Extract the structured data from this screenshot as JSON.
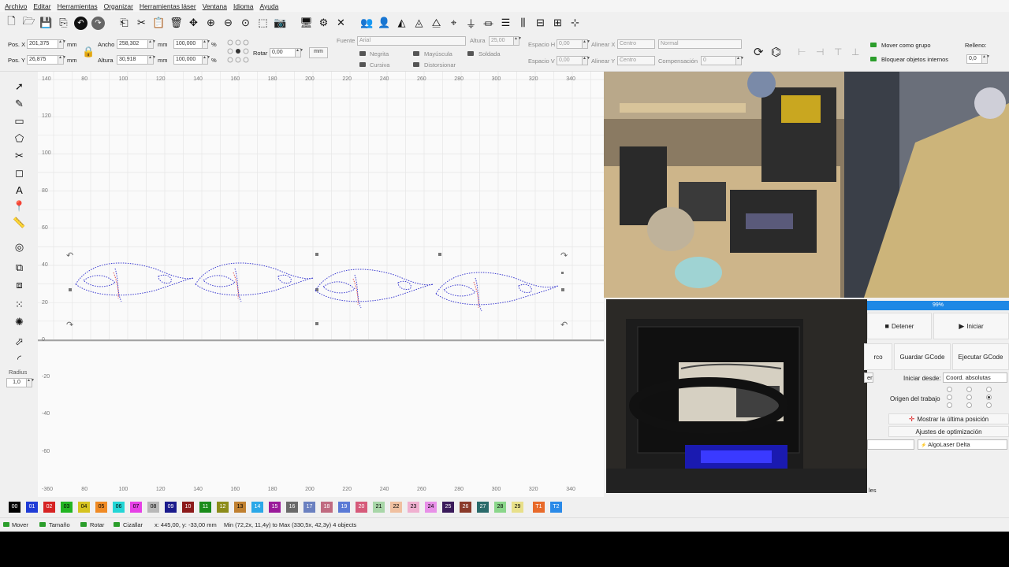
{
  "menu": [
    "Archivo",
    "Editar",
    "Herramientas",
    "Organizar",
    "Herramientas láser",
    "Ventana",
    "Idioma",
    "Ayuda"
  ],
  "props": {
    "pos_x_label": "Pos. X",
    "pos_x": "201,375",
    "pos_y_label": "Pos. Y",
    "pos_y": "26,875",
    "unit_mm": "mm",
    "width_label": "Ancho",
    "width": "258,302",
    "height_label": "Altura",
    "height": "30,918",
    "scale_w": "100,000",
    "scale_h": "100,000",
    "pct": "%",
    "rotate_label": "Rotar",
    "rotate": "0,00",
    "mm_button": "mm",
    "font_label": "Fuente",
    "font": "Arial",
    "font_height_label": "Altura",
    "font_height": "25,00",
    "bold": "Negrita",
    "italic": "Cursiva",
    "upper": "Mayúscula",
    "distort": "Distorsionar",
    "welded": "Soldada",
    "hspace_label": "Espacio H",
    "hspace": "0,00",
    "vspace_label": "Espacio V",
    "vspace": "0,00",
    "align_x_label": "Alinear X",
    "align_x": "Centro",
    "align_y_label": "Alinear Y",
    "align_y": "Centro",
    "mode": "Normal",
    "comp_label": "Compensación",
    "comp": "0",
    "move_group": "Mover como grupo",
    "lock_internal": "Bloquear objetos internos",
    "fill_label": "Relleno:",
    "fill": "0,0"
  },
  "left": {
    "radius_label": "Radius",
    "radius": "1,0"
  },
  "ruler": {
    "top": [
      "60",
      "80",
      "100",
      "120",
      "140",
      "160",
      "180",
      "200",
      "220",
      "240",
      "260",
      "280",
      "300",
      "320",
      "340"
    ],
    "top_first": "140",
    "bottom_first": "-360",
    "left": [
      "120",
      "100",
      "80",
      "60",
      "40",
      "20",
      "0",
      "-20",
      "-40",
      "-60"
    ]
  },
  "laser": {
    "progress": "99%",
    "stop": "Detener",
    "start": "Iniciar",
    "frame_partial": "rco",
    "save_gcode": "Guardar GCode",
    "run_gcode": "Ejecutar GCode",
    "start_from_label": "Iniciar desde:",
    "start_from": "Coord. absolutas",
    "job_origin_label": "Origen del trabajo",
    "show_last": "Mostrar la última posición",
    "optimization": "Ajustes de optimización",
    "left_partial": "en",
    "device": "AlgoLaser Delta",
    "tab_partial": "les"
  },
  "palette": [
    {
      "label": "00",
      "color": "#000000",
      "text": "#ffffff"
    },
    {
      "label": "01",
      "color": "#1f3bd6",
      "text": "#ffffff"
    },
    {
      "label": "02",
      "color": "#d62222",
      "text": "#ffffff"
    },
    {
      "label": "03",
      "color": "#22b522",
      "text": "#000000"
    },
    {
      "label": "04",
      "color": "#d6c31f",
      "text": "#000000"
    },
    {
      "label": "05",
      "color": "#f08a24",
      "text": "#000000"
    },
    {
      "label": "06",
      "color": "#23d6d6",
      "text": "#000000"
    },
    {
      "label": "07",
      "color": "#e640e6",
      "text": "#000000"
    },
    {
      "label": "08",
      "color": "#b8b8b8",
      "text": "#000000"
    },
    {
      "label": "09",
      "color": "#1a1a8c",
      "text": "#ffffff"
    },
    {
      "label": "10",
      "color": "#8c1a1a",
      "text": "#ffffff"
    },
    {
      "label": "11",
      "color": "#1a8c1a",
      "text": "#ffffff"
    },
    {
      "label": "12",
      "color": "#8c8c1a",
      "text": "#ffffff"
    },
    {
      "label": "13",
      "color": "#c08030",
      "text": "#000000"
    },
    {
      "label": "14",
      "color": "#2aa8e8",
      "text": "#ffffff"
    },
    {
      "label": "15",
      "color": "#9a1a9a",
      "text": "#ffffff"
    },
    {
      "label": "16",
      "color": "#6a6a6a",
      "text": "#ffffff"
    },
    {
      "label": "17",
      "color": "#6a80c0",
      "text": "#ffffff"
    },
    {
      "label": "18",
      "color": "#c06a80",
      "text": "#ffffff"
    },
    {
      "label": "19",
      "color": "#5a7ad6",
      "text": "#ffffff"
    },
    {
      "label": "20",
      "color": "#d65a7a",
      "text": "#ffffff"
    },
    {
      "label": "21",
      "color": "#a8d6a8",
      "text": "#000000"
    },
    {
      "label": "22",
      "color": "#f0c0a0",
      "text": "#000000"
    },
    {
      "label": "23",
      "color": "#f0b0d0",
      "text": "#000000"
    },
    {
      "label": "24",
      "color": "#e890e8",
      "text": "#000000"
    },
    {
      "label": "25",
      "color": "#3a1a5a",
      "text": "#ffffff"
    },
    {
      "label": "26",
      "color": "#8a3a2a",
      "text": "#ffffff"
    },
    {
      "label": "27",
      "color": "#2a6a6a",
      "text": "#ffffff"
    },
    {
      "label": "28",
      "color": "#8ad68a",
      "text": "#000000"
    },
    {
      "label": "29",
      "color": "#e8e08a",
      "text": "#000000"
    },
    {
      "label": "T1",
      "color": "#e86a2a",
      "text": "#ffffff"
    },
    {
      "label": "T2",
      "color": "#2a8ae8",
      "text": "#ffffff"
    }
  ],
  "status": {
    "move": "Mover",
    "size": "Tamaño",
    "rotate": "Rotar",
    "shear": "Cizallar",
    "coords": "x: 445,00, y: -33,00 mm",
    "bounds": "Min (72,2x, 11,4y) to Max (330,5x, 42,3y)  4 objects"
  }
}
